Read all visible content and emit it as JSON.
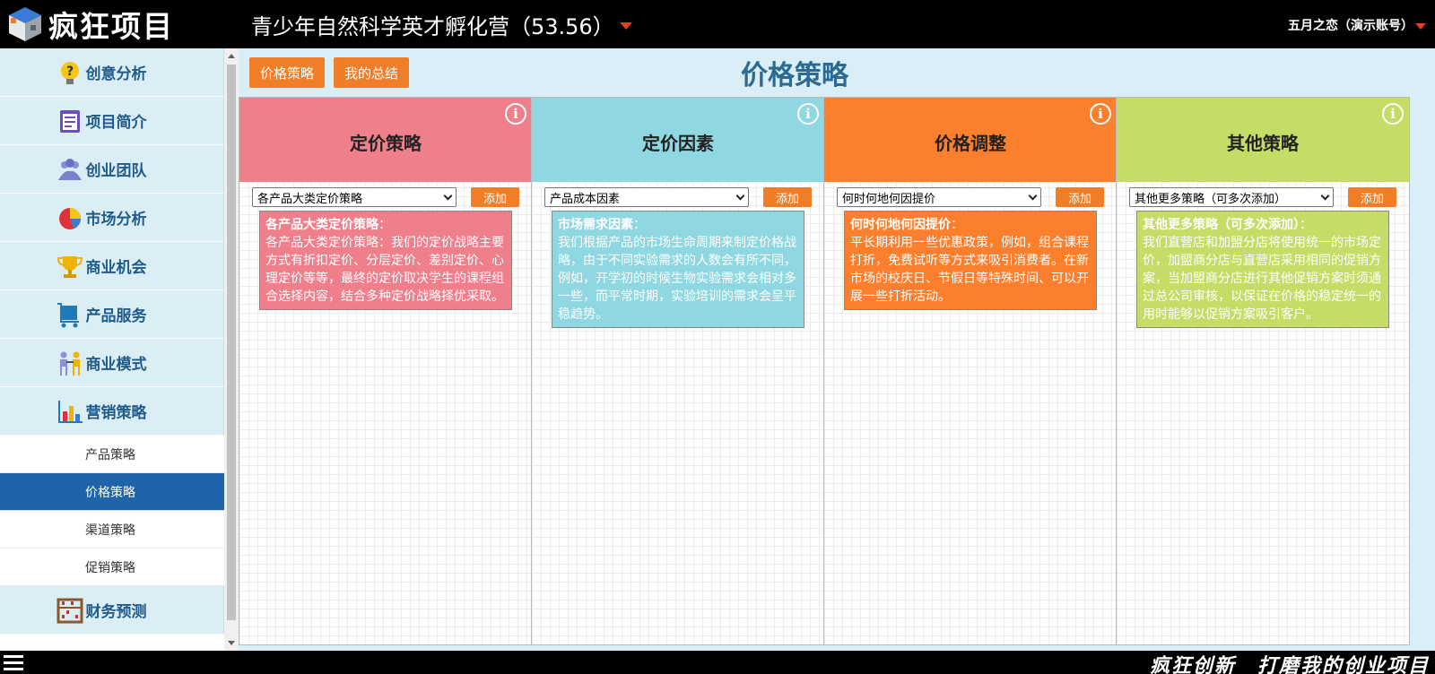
{
  "header": {
    "logo_text": "疯狂项目",
    "project_title": "青少年自然科学英才孵化营（53.56）",
    "user": "五月之恋（演示账号）"
  },
  "sidebar": {
    "items": [
      {
        "label": "创意分析",
        "icon": "lightbulb-question-icon"
      },
      {
        "label": "项目简介",
        "icon": "document-icon"
      },
      {
        "label": "创业团队",
        "icon": "team-icon"
      },
      {
        "label": "市场分析",
        "icon": "pie-chart-icon"
      },
      {
        "label": "商业机会",
        "icon": "trophy-icon"
      },
      {
        "label": "产品服务",
        "icon": "cart-icon"
      },
      {
        "label": "商业模式",
        "icon": "people-handshake-icon"
      },
      {
        "label": "营销策略",
        "icon": "bar-chart-icon"
      }
    ],
    "sub_items": [
      "产品策略",
      "价格策略",
      "渠道策略",
      "促销策略"
    ],
    "active_sub": "价格策略",
    "items_after": [
      {
        "label": "财务预测",
        "icon": "abacus-icon"
      }
    ]
  },
  "main": {
    "tabs": [
      "价格策略",
      "我的总结"
    ],
    "page_title": "价格策略",
    "add_label": "添加",
    "columns": [
      {
        "title": "定价策略",
        "color": "#f07f8c",
        "card_color": "#f07f8c",
        "select": "各产品大类定价策略",
        "card_title": "各产品大类定价策略",
        "card_text": "各产品大类定价策略：我们的定价战略主要方式有折扣定价、分层定价、差别定价、心理定价等等，最终的定价取决学生的课程组合选择内容，结合多种定价战略择优采取。"
      },
      {
        "title": "定价因素",
        "color": "#8fd8e2",
        "card_color": "#8fd8e2",
        "select": "产品成本因素",
        "card_title": "市场需求因素",
        "card_text": "我们根据产品的市场生命周期来制定价格战略，由于不同实验需求的人数会有所不同，例如，开学初的时候生物实验需求会相对多一些，而平常时期，实验培训的需求会呈平稳趋势。"
      },
      {
        "title": "价格调整",
        "color": "#fb7f2c",
        "card_color": "#fb7f2c",
        "select": "何时何地何因提价",
        "card_title": "何时何地何因提价",
        "card_text": "平长期利用一些优惠政策，例如，组合课程打折，免费试听等方式来吸引消费者。在新市场的校庆日、节假日等特殊时间、可以开展一些打折活动。"
      },
      {
        "title": "其他策略",
        "color": "#c5dd66",
        "card_color": "#c5dd66",
        "select": "其他更多策略（可多次添加）",
        "card_title": "其他更多策略（可多次添加）",
        "card_text": "我们直营店和加盟分店将使用统一的市场定价，加盟商分店与直营店采用相同的促销方案，当加盟商分店进行其他促销方案时须通过总公司审核，以保证在价格的稳定统一的用时能够以促销方案吸引客户。"
      }
    ]
  },
  "footer": {
    "slogan": "疯狂创新　打磨我的创业项目"
  }
}
